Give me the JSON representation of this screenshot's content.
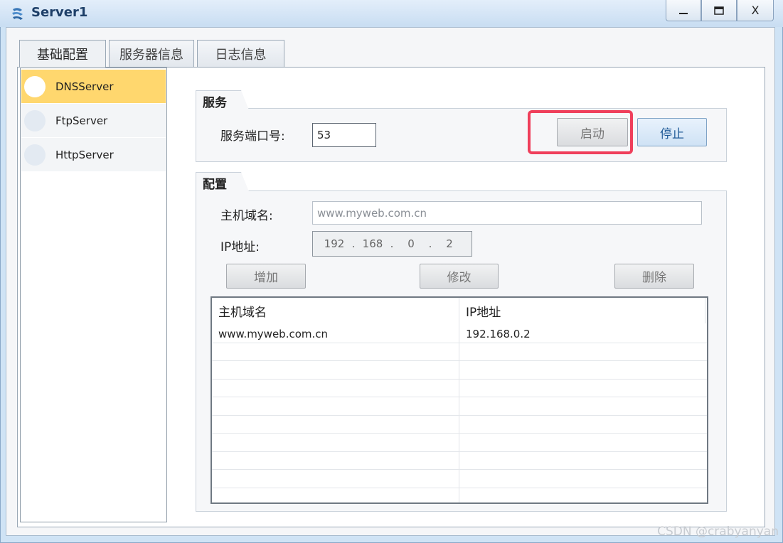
{
  "window": {
    "title": "Server1",
    "min_label": "—",
    "max_label": "☐",
    "close_label": "X"
  },
  "tabs": [
    {
      "label": "基础配置",
      "active": true
    },
    {
      "label": "服务器信息",
      "active": false
    },
    {
      "label": "日志信息",
      "active": false
    }
  ],
  "sidebar": {
    "items": [
      {
        "label": "DNSServer",
        "selected": true
      },
      {
        "label": "FtpServer",
        "selected": false
      },
      {
        "label": "HttpServer",
        "selected": false
      }
    ]
  },
  "service": {
    "group_title": "服务",
    "port_label": "服务端口号:",
    "port_value": "53",
    "start_label": "启动",
    "stop_label": "停止"
  },
  "config": {
    "group_title": "配置",
    "host_label": "主机域名:",
    "host_value": "www.myweb.com.cn",
    "ip_label": "IP地址:",
    "ip_octets": [
      "192",
      "168",
      "0",
      "2"
    ],
    "add_label": "增加",
    "modify_label": "修改",
    "delete_label": "删除",
    "table": {
      "columns": [
        "主机域名",
        "IP地址"
      ],
      "rows": [
        [
          "www.myweb.com.cn",
          "192.168.0.2"
        ]
      ]
    }
  },
  "watermark": "CSDN @crabyanyan",
  "colors": {
    "highlight": "#ef3f5b",
    "selected_item": "#ffd76e",
    "primary_text": "#1f5a97"
  }
}
